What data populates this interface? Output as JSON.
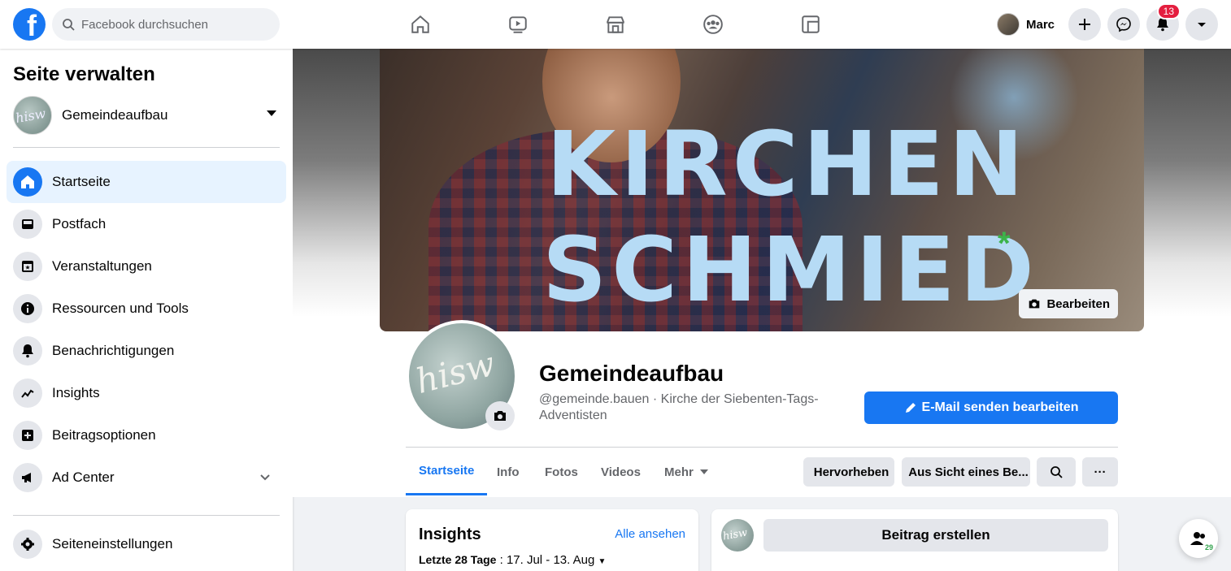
{
  "topbar": {
    "logo_letter": "f",
    "search_placeholder": "Facebook durchsuchen",
    "nav_icons": [
      "home-icon",
      "watch-icon",
      "marketplace-icon",
      "groups-icon",
      "gaming-icon"
    ],
    "user_name": "Marc",
    "notification_count": "13"
  },
  "sidebar": {
    "title": "Seite verwalten",
    "page_name": "Gemeindeaufbau",
    "items": [
      {
        "label": "Startseite",
        "icon": "home-icon"
      },
      {
        "label": "Postfach",
        "icon": "inbox-icon"
      },
      {
        "label": "Veranstaltungen",
        "icon": "calendar-icon"
      },
      {
        "label": "Ressourcen und Tools",
        "icon": "info-icon"
      },
      {
        "label": "Benachrichtigungen",
        "icon": "bell-icon"
      },
      {
        "label": "Insights",
        "icon": "chart-icon"
      },
      {
        "label": "Beitragsoptionen",
        "icon": "post-options-icon"
      },
      {
        "label": "Ad Center",
        "icon": "megaphone-icon"
      }
    ],
    "settings_label": "Seiteneinstellungen"
  },
  "cover": {
    "line1": "KIRCHEN",
    "line2": "SCHMIED",
    "asterisk": "*",
    "edit_label": "Bearbeiten"
  },
  "page": {
    "avatar_text": "hisw",
    "name": "Gemeindeaufbau",
    "meta": "@gemeinde.bauen · Kirche der Siebenten-Tags-Adventisten",
    "email_button": "E-Mail senden bearbeiten"
  },
  "tabs": [
    {
      "label": "Startseite"
    },
    {
      "label": "Info"
    },
    {
      "label": "Fotos"
    },
    {
      "label": "Videos"
    },
    {
      "label": "Mehr"
    }
  ],
  "actions": {
    "promote": "Hervorheben",
    "view_as": "Aus Sicht eines Be...",
    "more": "···"
  },
  "insights_card": {
    "title": "Insights",
    "link": "Alle ansehen",
    "range_label": "Letzte 28 Tage",
    "range_value": " : 17. Jul - 13. Aug"
  },
  "post_card": {
    "button": "Beitrag erstellen"
  },
  "float": {
    "count": "29"
  },
  "colors": {
    "accent": "#1877f2",
    "badge": "#e41e3f",
    "cover_text": "#b6dbf5",
    "asterisk": "#3cb34a"
  }
}
